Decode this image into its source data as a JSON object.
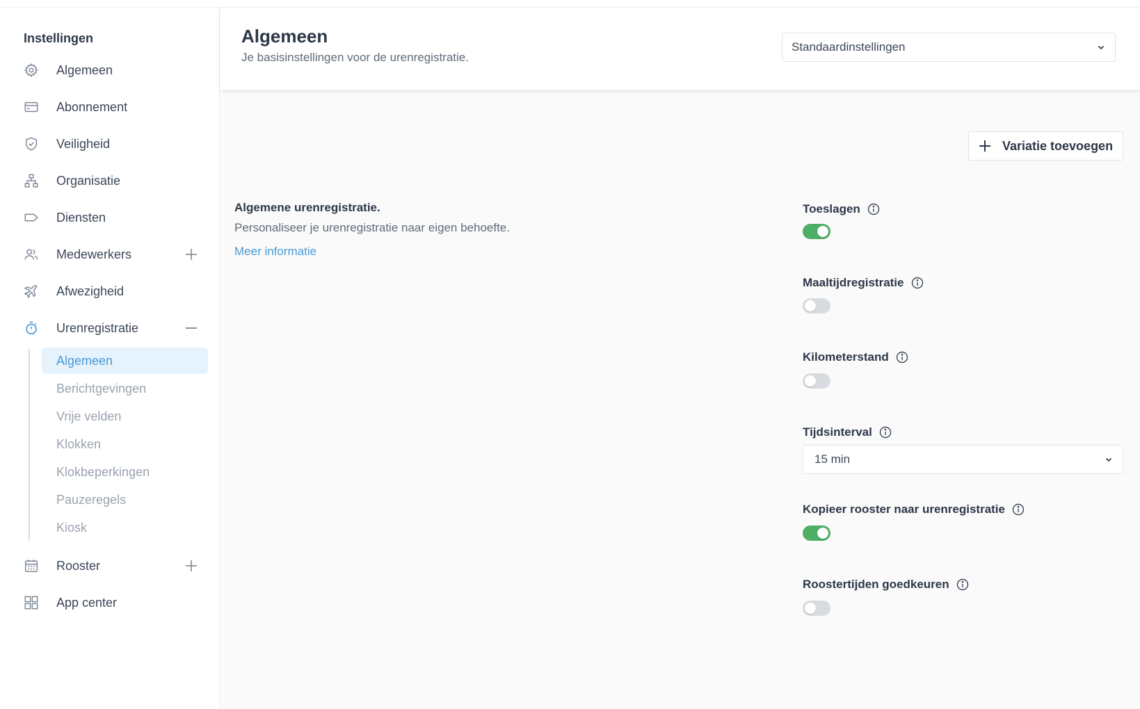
{
  "sidebar": {
    "title": "Instellingen",
    "items": [
      {
        "label": "Algemeen",
        "icon": "gear-icon"
      },
      {
        "label": "Abonnement",
        "icon": "credit-card-icon"
      },
      {
        "label": "Veiligheid",
        "icon": "shield-check-icon"
      },
      {
        "label": "Organisatie",
        "icon": "org-chart-icon"
      },
      {
        "label": "Diensten",
        "icon": "tag-icon"
      },
      {
        "label": "Medewerkers",
        "icon": "users-icon",
        "action": "plus-icon"
      },
      {
        "label": "Afwezigheid",
        "icon": "plane-icon"
      },
      {
        "label": "Urenregistratie",
        "icon": "stopwatch-icon",
        "action": "minus-icon"
      },
      {
        "label": "Rooster",
        "icon": "calendar-icon",
        "action": "plus-icon"
      },
      {
        "label": "App center",
        "icon": "grid-icon"
      }
    ],
    "subitems": [
      "Algemeen",
      "Berichtgevingen",
      "Vrije velden",
      "Klokken",
      "Klokbeperkingen",
      "Pauzeregels",
      "Kiosk"
    ],
    "active_subitem": "Algemeen"
  },
  "header": {
    "title": "Algemeen",
    "subtitle": "Je basisinstellingen voor de urenregistratie.",
    "select_value": "Standaardinstellingen"
  },
  "main": {
    "add_variation_label": "Variatie toevoegen",
    "section": {
      "title": "Algemene urenregistratie.",
      "description": "Personaliseer je urenregistratie naar eigen behoefte.",
      "link": "Meer informatie"
    },
    "settings": [
      {
        "label": "Toeslagen",
        "type": "toggle",
        "on": true
      },
      {
        "label": "Maaltijdregistratie",
        "type": "toggle",
        "on": false
      },
      {
        "label": "Kilometerstand",
        "type": "toggle",
        "on": false
      },
      {
        "label": "Tijdsinterval",
        "type": "select",
        "value": "15 min"
      },
      {
        "label": "Kopieer rooster naar urenregistratie",
        "type": "toggle",
        "on": true
      },
      {
        "label": "Roostertijden goedkeuren",
        "type": "toggle",
        "on": false
      }
    ]
  },
  "colors": {
    "accent": "#4a9ad6",
    "toggle_on": "#4caf63",
    "toggle_off": "#d8dce1",
    "active_bg": "#e6f2fc"
  }
}
